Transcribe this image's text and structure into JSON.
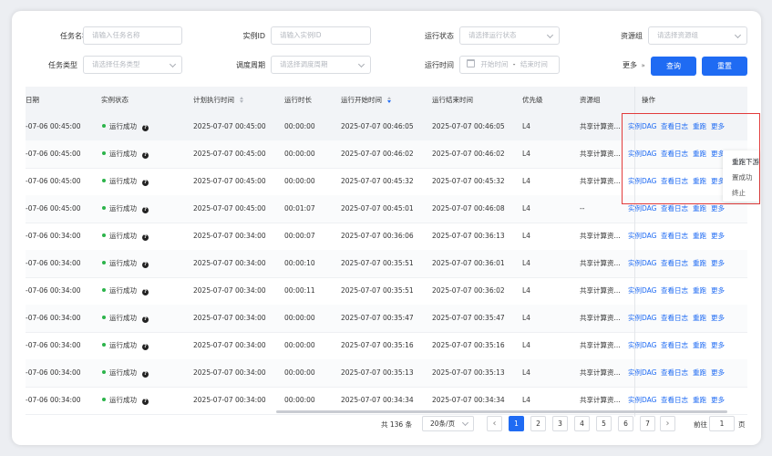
{
  "filters": {
    "task_name": {
      "label": "任务名称",
      "placeholder": "请输入任务名称"
    },
    "instance_id": {
      "label": "实例ID",
      "placeholder": "请输入实例ID"
    },
    "run_status": {
      "label": "运行状态",
      "placeholder": "请选择运行状态"
    },
    "resource_group": {
      "label": "资源组",
      "placeholder": "请选择资源组"
    },
    "task_type": {
      "label": "任务类型",
      "placeholder": "请选择任务类型"
    },
    "schedule_cycle": {
      "label": "调度周期",
      "placeholder": "请选择调度周期"
    },
    "run_time": {
      "label": "运行时间",
      "start_placeholder": "开始时间",
      "separator": "-",
      "end_placeholder": "结束时间"
    },
    "more_label": "更多",
    "query_label": "查询",
    "reset_label": "重置"
  },
  "table": {
    "columns": [
      "日期",
      "实例状态",
      "计划执行时间",
      "运行时长",
      "运行开始时间",
      "运行结束时间",
      "优先级",
      "资源组",
      "操作"
    ],
    "status_help_icon": "?",
    "actions": [
      "实例DAG",
      "查看日志",
      "重跑",
      "更多"
    ],
    "rows": [
      {
        "date": "-07-06 00:45:00",
        "status": "运行成功",
        "plan": "2025-07-07 00:45:00",
        "duration": "00:00:00",
        "start": "2025-07-07 00:46:05",
        "end": "2025-07-07 00:46:05",
        "priority": "L4",
        "group": "共享计算资..."
      },
      {
        "date": "-07-06 00:45:00",
        "status": "运行成功",
        "plan": "2025-07-07 00:45:00",
        "duration": "00:00:00",
        "start": "2025-07-07 00:46:02",
        "end": "2025-07-07 00:46:02",
        "priority": "L4",
        "group": "共享计算资..."
      },
      {
        "date": "-07-06 00:45:00",
        "status": "运行成功",
        "plan": "2025-07-07 00:45:00",
        "duration": "00:00:00",
        "start": "2025-07-07 00:45:32",
        "end": "2025-07-07 00:45:32",
        "priority": "L4",
        "group": "共享计算资..."
      },
      {
        "date": "-07-06 00:45:00",
        "status": "运行成功",
        "plan": "2025-07-07 00:45:00",
        "duration": "00:01:07",
        "start": "2025-07-07 00:45:01",
        "end": "2025-07-07 00:46:08",
        "priority": "L4",
        "group": "--"
      },
      {
        "date": "-07-06 00:34:00",
        "status": "运行成功",
        "plan": "2025-07-07 00:34:00",
        "duration": "00:00:07",
        "start": "2025-07-07 00:36:06",
        "end": "2025-07-07 00:36:13",
        "priority": "L4",
        "group": "共享计算资..."
      },
      {
        "date": "-07-06 00:34:00",
        "status": "运行成功",
        "plan": "2025-07-07 00:34:00",
        "duration": "00:00:10",
        "start": "2025-07-07 00:35:51",
        "end": "2025-07-07 00:36:01",
        "priority": "L4",
        "group": "共享计算资..."
      },
      {
        "date": "-07-06 00:34:00",
        "status": "运行成功",
        "plan": "2025-07-07 00:34:00",
        "duration": "00:00:11",
        "start": "2025-07-07 00:35:51",
        "end": "2025-07-07 00:36:02",
        "priority": "L4",
        "group": "共享计算资..."
      },
      {
        "date": "-07-06 00:34:00",
        "status": "运行成功",
        "plan": "2025-07-07 00:34:00",
        "duration": "00:00:00",
        "start": "2025-07-07 00:35:47",
        "end": "2025-07-07 00:35:47",
        "priority": "L4",
        "group": "共享计算资..."
      },
      {
        "date": "-07-06 00:34:00",
        "status": "运行成功",
        "plan": "2025-07-07 00:34:00",
        "duration": "00:00:00",
        "start": "2025-07-07 00:35:16",
        "end": "2025-07-07 00:35:16",
        "priority": "L4",
        "group": "共享计算资..."
      },
      {
        "date": "-07-06 00:34:00",
        "status": "运行成功",
        "plan": "2025-07-07 00:34:00",
        "duration": "00:00:00",
        "start": "2025-07-07 00:35:13",
        "end": "2025-07-07 00:35:13",
        "priority": "L4",
        "group": "共享计算资..."
      },
      {
        "date": "-07-06 00:34:00",
        "status": "运行成功",
        "plan": "2025-07-07 00:34:00",
        "duration": "00:00:00",
        "start": "2025-07-07 00:34:34",
        "end": "2025-07-07 00:34:34",
        "priority": "L4",
        "group": "共享计算资..."
      }
    ]
  },
  "more_menu": {
    "items": [
      "重跑下游",
      "置成功",
      "终止"
    ]
  },
  "pagination": {
    "total": "共 136 条",
    "page_size": "20条/页",
    "pages": [
      "1",
      "2",
      "3",
      "4",
      "5",
      "6",
      "7"
    ],
    "current": "1",
    "prev": "‹",
    "next": "›",
    "goto_label": "前往",
    "goto_value": "1",
    "page_suffix": "页"
  },
  "colors": {
    "accent": "#1f6bf3",
    "success": "#2bb34a",
    "highlight_border": "#e23b3b"
  }
}
